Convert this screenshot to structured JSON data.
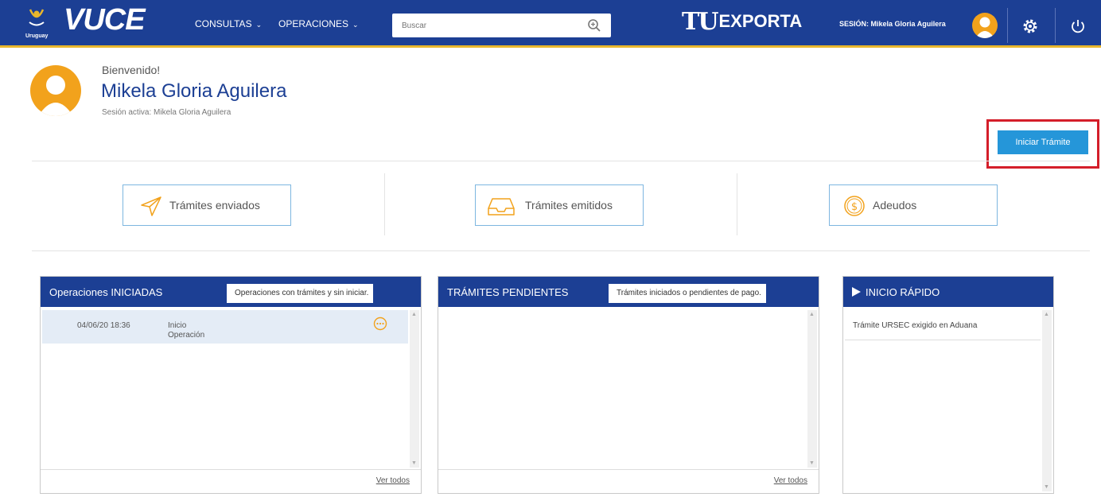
{
  "header": {
    "brand": "VUCE",
    "country": "Uruguay",
    "menu": [
      {
        "label": "CONSULTAS"
      },
      {
        "label": "OPERACIONES"
      }
    ],
    "search": {
      "placeholder": "Buscar"
    },
    "partner_logo": {
      "prefix": "TU",
      "label": "EXPORTA"
    },
    "session_label": "SESIÓN: Mikela Gloria Aguilera",
    "colors": {
      "bar": "#1c3f94",
      "accent": "#e8b62c",
      "avatar": "#f2a21c"
    }
  },
  "welcome": {
    "greeting": "Bienvenido!",
    "user_name": "Mikela Gloria Aguilera",
    "active_session": "Sesión activa: Mikela Gloria Aguilera"
  },
  "actions": {
    "start_label": "Iniciar Trámite",
    "highlight_color": "#d41e2a"
  },
  "shortcuts": [
    {
      "label": "Trámites enviados",
      "icon": "send-icon"
    },
    {
      "label": "Trámites emitidos",
      "icon": "inbox-tray-icon"
    },
    {
      "label": "Adeudos",
      "icon": "dollar-coin-icon"
    }
  ],
  "panels": {
    "operations": {
      "title": "Operaciones INICIADAS",
      "badge": "Operaciones con trámites y sin iniciar.",
      "rows": [
        {
          "date": "04/06/20 18:36",
          "status_line1": "Inicio",
          "status_line2": "Operación"
        }
      ],
      "view_all": "Ver todos"
    },
    "pending": {
      "title": "TRÁMITES PENDIENTES",
      "badge": "Trámites iniciados o pendientes de pago.",
      "view_all": "Ver todos"
    },
    "quickstart": {
      "title": "INICIO RÁPIDO",
      "items": [
        {
          "label": "Trámite URSEC exigido en Aduana"
        }
      ]
    }
  }
}
